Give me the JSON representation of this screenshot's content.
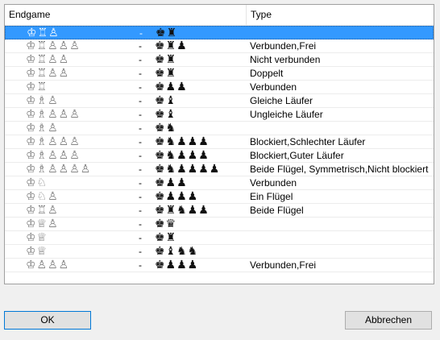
{
  "columns": {
    "endgame": "Endgame",
    "type": "Type"
  },
  "rows": [
    {
      "white": "♔♖♙",
      "sep": "-",
      "black": "♚♜",
      "type": "",
      "selected": true
    },
    {
      "white": "♔♖♙♙♙",
      "sep": "-",
      "black": "♚♜♟",
      "type": "Verbunden,Frei"
    },
    {
      "white": "♔♖♙♙",
      "sep": "-",
      "black": "♚♜",
      "type": "Nicht verbunden"
    },
    {
      "white": "♔♖♙♙",
      "sep": "-",
      "black": "♚♜",
      "type": "Doppelt"
    },
    {
      "white": "♔♖",
      "sep": "-",
      "black": "♚♟♟",
      "type": "Verbunden"
    },
    {
      "white": "♔♗♙",
      "sep": "-",
      "black": "♚♝",
      "type": "Gleiche Läufer"
    },
    {
      "white": "♔♗♙♙♙",
      "sep": "-",
      "black": "♚♝",
      "type": "Ungleiche Läufer"
    },
    {
      "white": "♔♗♙",
      "sep": "-",
      "black": "♚♞",
      "type": ""
    },
    {
      "white": "♔♗♙♙♙",
      "sep": "-",
      "black": "♚♞♟♟♟",
      "type": "Blockiert,Schlechter Läufer"
    },
    {
      "white": "♔♗♙♙♙",
      "sep": "-",
      "black": "♚♞♟♟♟",
      "type": "Blockiert,Guter Läufer"
    },
    {
      "white": "♔♗♙♙♙♙",
      "sep": "-",
      "black": "♚♞♟♟♟♟",
      "type": "Beide Flügel, Symmetrisch,Nicht blockiert"
    },
    {
      "white": "♔♘",
      "sep": "-",
      "black": "♚♟♟",
      "type": "Verbunden"
    },
    {
      "white": "♔♘♙",
      "sep": "-",
      "black": "♚♟♟♟",
      "type": "Ein Flügel"
    },
    {
      "white": "♔♖♙",
      "sep": "-",
      "black": "♚♜♞♟♟",
      "type": "Beide Flügel"
    },
    {
      "white": "♔♕♙",
      "sep": "-",
      "black": "♚♛",
      "type": ""
    },
    {
      "white": "♔♕",
      "sep": "-",
      "black": "♚♜",
      "type": ""
    },
    {
      "white": "♔♕",
      "sep": "-",
      "black": "♚♝♞♞",
      "type": ""
    },
    {
      "white": "♔♙♙♙",
      "sep": "-",
      "black": "♚♟♟♟",
      "type": "Verbunden,Frei"
    }
  ],
  "buttons": {
    "ok": "OK",
    "cancel": "Abbrechen"
  },
  "colors": {
    "selection": "#3399ff",
    "ok_border": "#0078d7"
  }
}
